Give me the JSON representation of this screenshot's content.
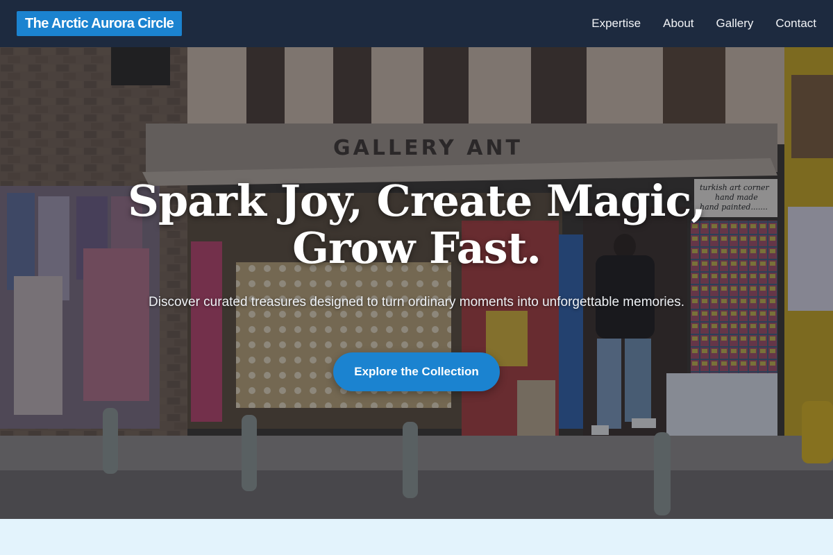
{
  "header": {
    "brand": "The Arctic Aurora Circle",
    "nav": [
      {
        "label": "Expertise"
      },
      {
        "label": "About"
      },
      {
        "label": "Gallery"
      },
      {
        "label": "Contact"
      }
    ]
  },
  "hero": {
    "background_scene": {
      "shop_sign": "GALLERY ANT",
      "side_sign": [
        "turkish art corner",
        "hand made",
        "hand painted......."
      ]
    },
    "title": "Spark Joy, Create Magic, Grow Fast.",
    "subtitle": "Discover curated treasures designed to turn ordinary moments into unforgettable memories.",
    "cta_label": "Explore the Collection"
  },
  "colors": {
    "navbar_bg": "#1d2a3f",
    "accent": "#1b83d0",
    "section_bg": "#e3f3fc"
  }
}
